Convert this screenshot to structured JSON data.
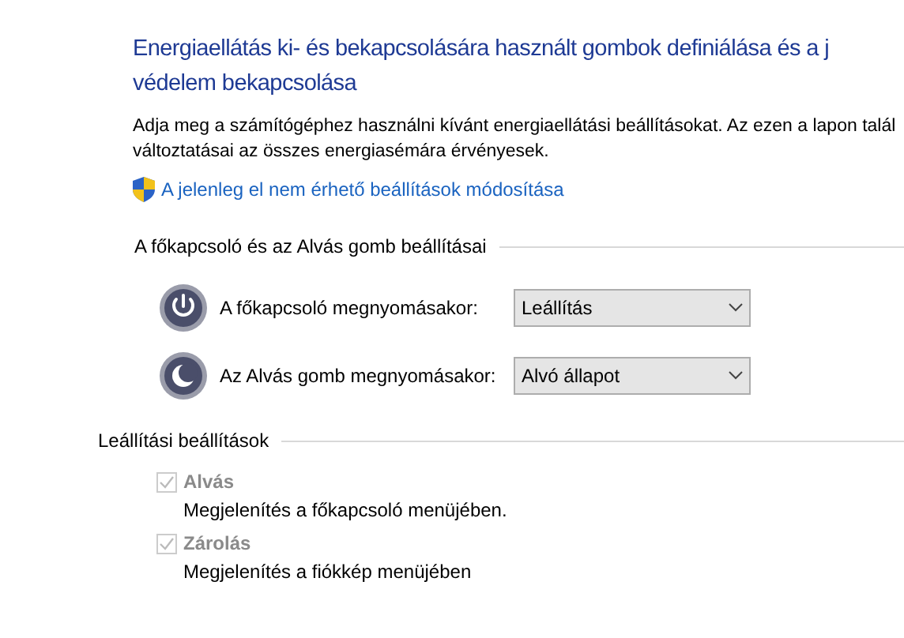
{
  "title_lines": [
    "Energiaellátás ki- és bekapcsolására használt gombok definiálása és a j",
    "védelem bekapcsolása"
  ],
  "description_lines": [
    "Adja meg a számítógéphez használni kívánt energiaellátási beállításokat. Az ezen a lapon talál",
    "változtatásai az összes energiasémára érvényesek."
  ],
  "admin_link": "A jelenleg el nem érhető beállítások módosítása",
  "buttons_section": {
    "heading": "A főkapcsoló és az Alvás gomb beállításai",
    "rows": [
      {
        "kind": "power",
        "label": "A főkapcsoló megnyomásakor:",
        "value": "Leállítás"
      },
      {
        "kind": "sleep",
        "label": "Az Alvás gomb megnyomásakor:",
        "value": "Alvó állapot"
      }
    ]
  },
  "shutdown_section": {
    "heading": "Leállítási beállítások",
    "options": [
      {
        "label": "Alvás",
        "description": "Megjelenítés a főkapcsoló menüjében.",
        "checked": true,
        "disabled": true
      },
      {
        "label": "Zárolás",
        "description": "Megjelenítés a fiókkép menüjében",
        "checked": true,
        "disabled": true
      }
    ]
  }
}
